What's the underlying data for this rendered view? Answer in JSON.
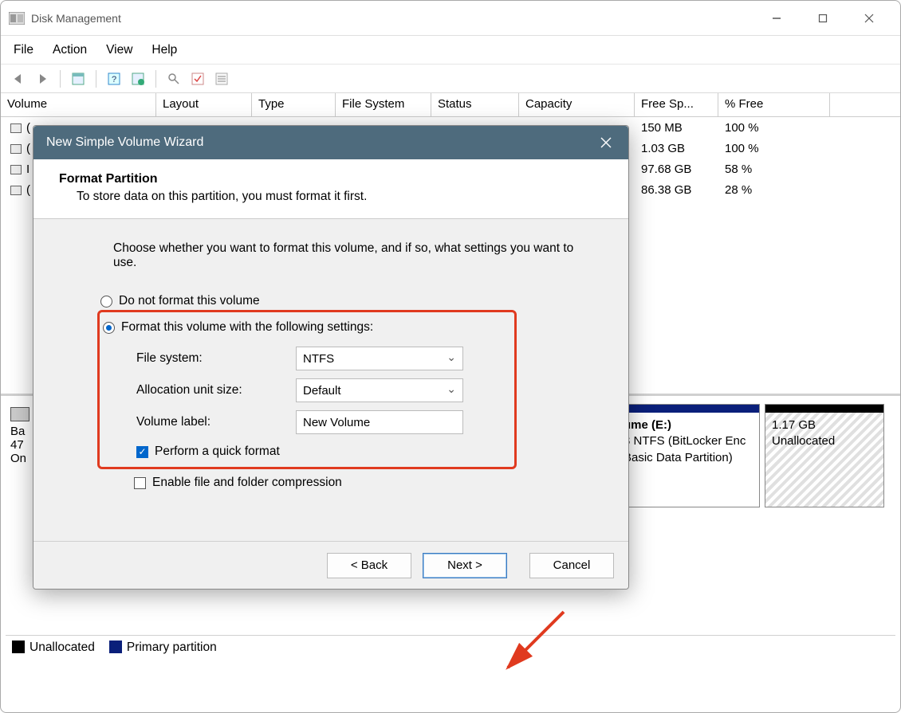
{
  "window": {
    "title": "Disk Management"
  },
  "menubar": [
    "File",
    "Action",
    "View",
    "Help"
  ],
  "table": {
    "headers": [
      "Volume",
      "Layout",
      "Type",
      "File System",
      "Status",
      "Capacity",
      "Free Sp...",
      "% Free"
    ],
    "rows": [
      {
        "free": "150 MB",
        "pct": "100 %"
      },
      {
        "free": "1.03 GB",
        "pct": "100 %"
      },
      {
        "free": "97.68 GB",
        "pct": "58 %"
      },
      {
        "free": "86.38 GB",
        "pct": "28 %"
      }
    ]
  },
  "disk": {
    "label_line1": "Ba",
    "label_line2": "47",
    "label_line3": "On",
    "parts": [
      {
        "title": "ume  (E:)",
        "line2": "3 NTFS (BitLocker Enc",
        "line3": "Basic Data Partition)"
      },
      {
        "title": "1.17 GB",
        "line2": "Unallocated"
      }
    ]
  },
  "legend": {
    "unallocated": "Unallocated",
    "primary": "Primary partition"
  },
  "wizard": {
    "title": "New Simple Volume Wizard",
    "page_title": "Format Partition",
    "page_sub": "To store data on this partition, you must format it first.",
    "intro": "Choose whether you want to format this volume, and if so, what settings you want to use.",
    "opt_noformat": "Do not format this volume",
    "opt_format": "Format this volume with the following settings:",
    "fs_label": "File system:",
    "fs_value": "NTFS",
    "au_label": "Allocation unit size:",
    "au_value": "Default",
    "vl_label": "Volume label:",
    "vl_value": "New Volume",
    "quick_format": "Perform a quick format",
    "compression": "Enable file and folder compression",
    "back": "< Back",
    "next": "Next >",
    "cancel": "Cancel"
  }
}
